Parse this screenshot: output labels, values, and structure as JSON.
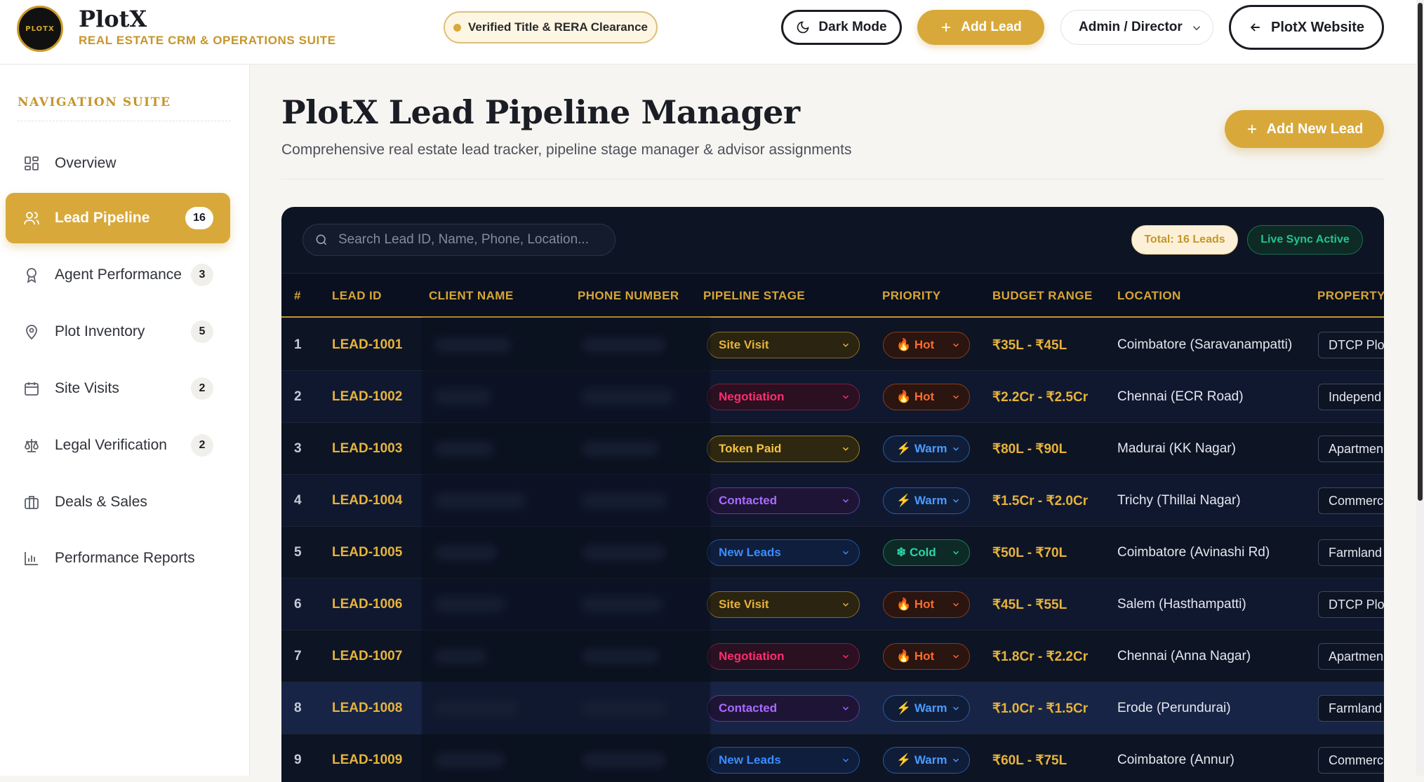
{
  "brand": {
    "logo_text": "PLOTX",
    "name": "PlotX",
    "tagline": "REAL ESTATE CRM & OPERATIONS SUITE"
  },
  "header": {
    "verified_badge": "Verified Title & RERA Clearance",
    "dark_mode_label": "Dark Mode",
    "add_lead_label": "Add Lead",
    "role_select_value": "Admin / Director",
    "website_label": "PlotX Website"
  },
  "sidebar": {
    "title": "NAVIGATION SUITE",
    "items": [
      {
        "label": "Overview",
        "badge": "",
        "icon": "grid-icon"
      },
      {
        "label": "Lead Pipeline",
        "badge": "16",
        "icon": "users-icon"
      },
      {
        "label": "Agent Performance",
        "badge": "3",
        "icon": "award-icon"
      },
      {
        "label": "Plot Inventory",
        "badge": "5",
        "icon": "map-pin-icon"
      },
      {
        "label": "Site Visits",
        "badge": "2",
        "icon": "calendar-icon"
      },
      {
        "label": "Legal Verification",
        "badge": "2",
        "icon": "scale-icon"
      },
      {
        "label": "Deals & Sales",
        "badge": "",
        "icon": "briefcase-icon"
      },
      {
        "label": "Performance Reports",
        "badge": "",
        "icon": "bar-chart-icon"
      }
    ]
  },
  "main": {
    "title": "PlotX Lead Pipeline Manager",
    "subtitle": "Comprehensive real estate lead tracker, pipeline stage manager & advisor assignments",
    "add_new_label": "Add New Lead"
  },
  "table_panel": {
    "search_placeholder": "Search Lead ID, Name, Phone, Location...",
    "total_label": "Total: 16 Leads",
    "sync_label": "Live Sync Active",
    "columns": [
      "#",
      "LEAD ID",
      "CLIENT NAME",
      "PHONE NUMBER",
      "PIPELINE STAGE",
      "PRIORITY",
      "BUDGET RANGE",
      "LOCATION",
      "PROPERTY"
    ],
    "rows": [
      {
        "num": "1",
        "id": "LEAD-1001",
        "stage": "Site Visit",
        "priority": "🔥 Hot",
        "budget": "₹35L - ₹45L",
        "location": "Coimbatore (Saravanampatti)",
        "property": "DTCP Plo"
      },
      {
        "num": "2",
        "id": "LEAD-1002",
        "stage": "Negotiation",
        "priority": "🔥 Hot",
        "budget": "₹2.2Cr - ₹2.5Cr",
        "location": "Chennai (ECR Road)",
        "property": "Independ"
      },
      {
        "num": "3",
        "id": "LEAD-1003",
        "stage": "Token Paid",
        "priority": "⚡ Warm",
        "budget": "₹80L - ₹90L",
        "location": "Madurai (KK Nagar)",
        "property": "Apartmen"
      },
      {
        "num": "4",
        "id": "LEAD-1004",
        "stage": "Contacted",
        "priority": "⚡ Warm",
        "budget": "₹1.5Cr - ₹2.0Cr",
        "location": "Trichy (Thillai Nagar)",
        "property": "Commerc"
      },
      {
        "num": "5",
        "id": "LEAD-1005",
        "stage": "New Leads",
        "priority": "❄ Cold",
        "budget": "₹50L - ₹70L",
        "location": "Coimbatore (Avinashi Rd)",
        "property": "Farmland"
      },
      {
        "num": "6",
        "id": "LEAD-1006",
        "stage": "Site Visit",
        "priority": "🔥 Hot",
        "budget": "₹45L - ₹55L",
        "location": "Salem (Hasthampatti)",
        "property": "DTCP Plo"
      },
      {
        "num": "7",
        "id": "LEAD-1007",
        "stage": "Negotiation",
        "priority": "🔥 Hot",
        "budget": "₹1.8Cr - ₹2.2Cr",
        "location": "Chennai (Anna Nagar)",
        "property": "Apartmen"
      },
      {
        "num": "8",
        "id": "LEAD-1008",
        "stage": "Contacted",
        "priority": "⚡ Warm",
        "budget": "₹1.0Cr - ₹1.5Cr",
        "location": "Erode (Perundurai)",
        "property": "Farmland"
      },
      {
        "num": "9",
        "id": "LEAD-1009",
        "stage": "New Leads",
        "priority": "⚡ Warm",
        "budget": "₹60L - ₹75L",
        "location": "Coimbatore (Annur)",
        "property": "Commerc"
      }
    ]
  },
  "colors": {
    "accent": "#d8a93a",
    "panel_bg": "#0d1424",
    "stage_site_visit": "#e6b33c",
    "stage_negotiation": "#ff2d6f",
    "stage_token_paid": "#f5c242",
    "stage_contacted": "#a86bff",
    "stage_new_leads": "#3b8cff",
    "prio_hot": "#ff6a2c",
    "prio_warm": "#4a9bff",
    "prio_cold": "#2dd4a8"
  }
}
